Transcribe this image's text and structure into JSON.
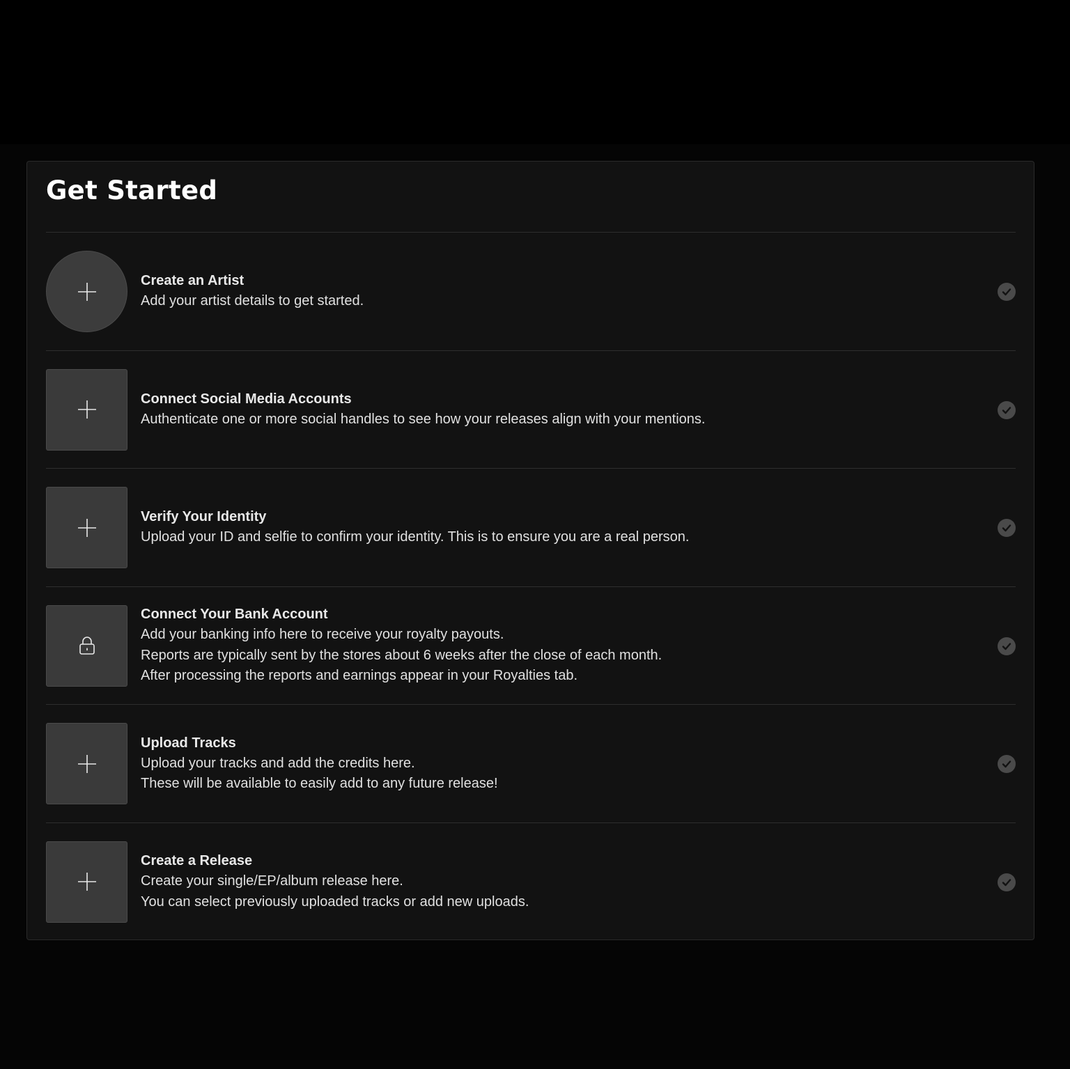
{
  "page": {
    "title": "Get Started"
  },
  "colors": {
    "background": "#000000",
    "card": "#121212",
    "tile": "#3a3a3a",
    "check": "#4a4a4a"
  },
  "steps": [
    {
      "title": "Create an Artist",
      "lines": [
        "Add your artist details to get started."
      ],
      "icon": "plus-icon",
      "shape": "circle",
      "status_icon": "check-circle-icon"
    },
    {
      "title": "Connect Social Media Accounts",
      "lines": [
        "Authenticate one or more social handles to see how your releases align with your mentions."
      ],
      "icon": "plus-icon",
      "shape": "square",
      "status_icon": "check-circle-icon"
    },
    {
      "title": "Verify Your Identity",
      "lines": [
        "Upload your ID and selfie to confirm your identity. This is to ensure you are a real person."
      ],
      "icon": "plus-icon",
      "shape": "square",
      "status_icon": "check-circle-icon"
    },
    {
      "title": "Connect Your Bank Account",
      "lines": [
        "Add your banking info here to receive your royalty payouts.",
        "Reports are typically sent by the stores about 6 weeks after the close of each month.",
        "After processing the reports and earnings appear in your Royalties tab."
      ],
      "icon": "lock-icon",
      "shape": "square",
      "status_icon": "check-circle-icon"
    },
    {
      "title": "Upload Tracks",
      "lines": [
        "Upload your tracks and add the credits here.",
        "These will be available to easily add to any future release!"
      ],
      "icon": "plus-icon",
      "shape": "square",
      "status_icon": "check-circle-icon"
    },
    {
      "title": "Create a Release",
      "lines": [
        "Create your single/EP/album release here.",
        "You can select previously uploaded tracks or add new uploads."
      ],
      "icon": "plus-icon",
      "shape": "square",
      "status_icon": "check-circle-icon"
    }
  ]
}
